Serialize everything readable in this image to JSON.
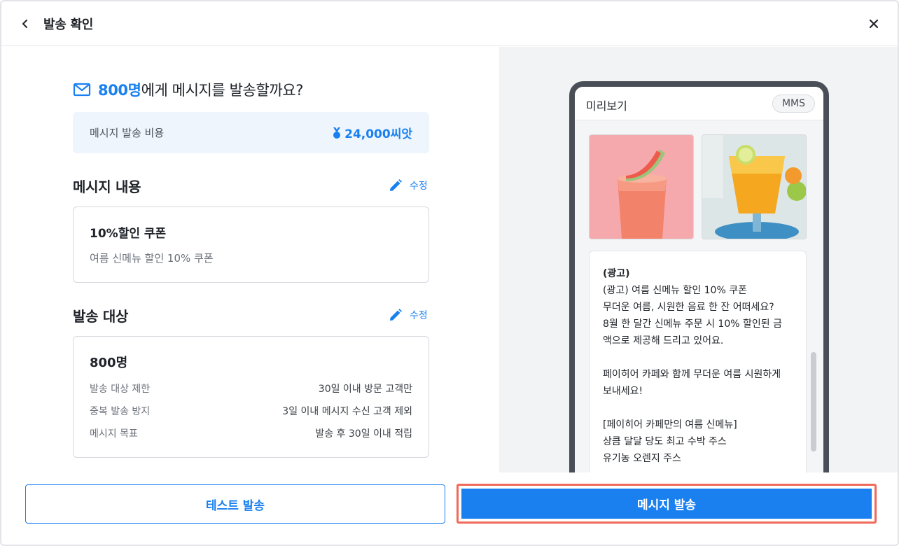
{
  "header": {
    "title": "발송 확인"
  },
  "summary": {
    "count": "800명",
    "question_rest": "에게 메시지를 발송할까요?",
    "cost_label": "메시지 발송 비용",
    "cost_value": "24,000씨앗"
  },
  "message_section": {
    "title": "메시지 내용",
    "edit_label": "수정",
    "coupon_title": "10%할인 쿠폰",
    "coupon_desc": "여름 신메뉴 할인 10% 쿠폰"
  },
  "target_section": {
    "title": "발송 대상",
    "edit_label": "수정",
    "count": "800명",
    "rows": [
      {
        "label": "발송 대상 제한",
        "value": "30일 이내 방문 고객만"
      },
      {
        "label": "중복 발송 방지",
        "value": "3일 이내 메시지 수신 고객 제외"
      },
      {
        "label": "메시지 목표",
        "value": "발송 후 30일 이내 적립"
      }
    ]
  },
  "preview": {
    "title": "미리보기",
    "badge": "MMS",
    "lines": [
      "(광고)",
      "(광고) 여름 신메뉴 할인 10% 쿠폰",
      "무더운 여름, 시원한 음료 한 잔 어떠세요?",
      "8월 한 달간 신메뉴 주문 시 10% 할인된 금",
      "액으로 제공해 드리고 있어요.",
      "",
      "페이히어 카페와 함께 무더운 여름 시원하게",
      "보내세요!",
      "",
      "[페이히어 카페만의 여름 신메뉴]",
      "상큼 달달 당도 최고 수박 주스",
      "유기농 오렌지 주스"
    ]
  },
  "footer": {
    "test_label": "테스트 발송",
    "send_label": "메시지 발송"
  },
  "colors": {
    "accent": "#1a80f0",
    "highlight_outline": "#f06a5a",
    "cost_bg": "#eef5fd"
  },
  "icons": [
    "chevron-left-icon",
    "close-icon",
    "mail-icon",
    "medal-icon",
    "pencil-icon"
  ]
}
